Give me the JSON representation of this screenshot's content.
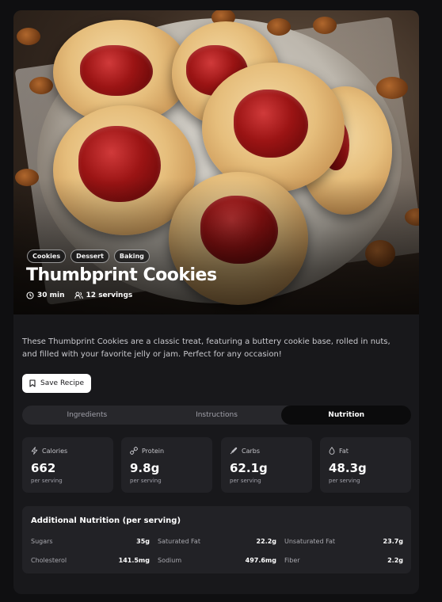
{
  "recipe": {
    "title": "Thumbprint Cookies",
    "tags": [
      "Cookies",
      "Dessert",
      "Baking"
    ],
    "time": "30 min",
    "servings": "12 servings",
    "description": "These Thumbprint Cookies are a classic treat, featuring a buttery cookie base, rolled in nuts, and filled with your favorite jelly or jam. Perfect for any occasion!",
    "save_label": "Save Recipe"
  },
  "tabs": [
    {
      "label": "Ingredients",
      "active": false
    },
    {
      "label": "Instructions",
      "active": false
    },
    {
      "label": "Nutrition",
      "active": true
    }
  ],
  "nutrition": {
    "cards": [
      {
        "label": "Calories",
        "value": "662",
        "sub": "per serving",
        "icon": "bolt-icon"
      },
      {
        "label": "Protein",
        "value": "9.8g",
        "sub": "per serving",
        "icon": "dumbbell-icon"
      },
      {
        "label": "Carbs",
        "value": "62.1g",
        "sub": "per serving",
        "icon": "wheat-icon"
      },
      {
        "label": "Fat",
        "value": "48.3g",
        "sub": "per serving",
        "icon": "droplet-icon"
      }
    ],
    "additional_title": "Additional Nutrition (per serving)",
    "additional": [
      {
        "label": "Sugars",
        "value": "35g"
      },
      {
        "label": "Saturated Fat",
        "value": "22.2g"
      },
      {
        "label": "Unsaturated Fat",
        "value": "23.7g"
      },
      {
        "label": "Cholesterol",
        "value": "141.5mg"
      },
      {
        "label": "Sodium",
        "value": "497.6mg"
      },
      {
        "label": "Fiber",
        "value": "2.2g"
      }
    ]
  },
  "colors": {
    "background": "#0f0f11",
    "card": "#18181b",
    "panel": "#222226",
    "tab_track": "#27272b",
    "active_tab": "#0b0b0c",
    "jam": "#9b1414"
  }
}
